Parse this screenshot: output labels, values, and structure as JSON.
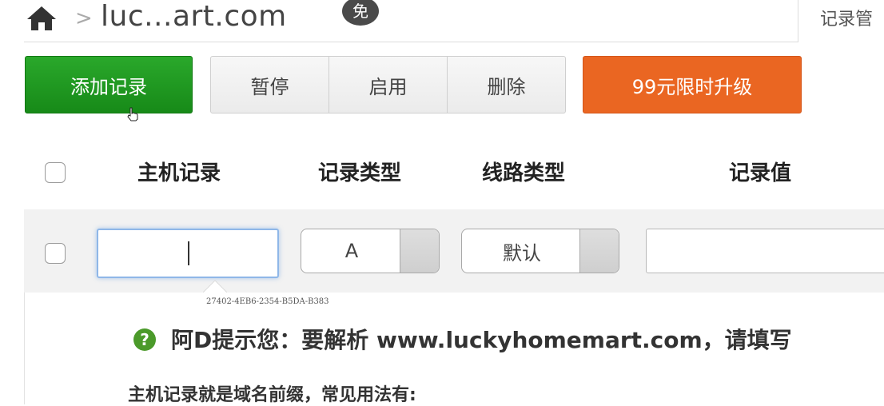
{
  "breadcrumb": {
    "domain": "luc...art.com",
    "badge": "免"
  },
  "top_right": {
    "link": "记录管"
  },
  "toolbar": {
    "add_label": "添加记录",
    "pause_label": "暂停",
    "enable_label": "启用",
    "delete_label": "删除",
    "upgrade_label": "99元限时升级"
  },
  "table": {
    "headers": [
      "主机记录",
      "记录类型",
      "线路类型",
      "记录值"
    ]
  },
  "edit_row": {
    "host_value": "",
    "record_type": "A",
    "line_type": "默认",
    "record_value": ""
  },
  "tip": {
    "serial": "27402-4EB6-2354-B5DA-B383",
    "headline": "阿D提示您：要解析 www.luckyhomemart.com，请填写",
    "subline": "主机记录就是域名前缀，常见用法有:"
  },
  "colors": {
    "add_button": "#1f9a20",
    "upgrade_button": "#ea6622",
    "focus_border": "#8fb7e8",
    "help_icon": "#4b9a2a"
  },
  "icons": [
    "home-icon",
    "free-badge",
    "pointer-cursor-icon",
    "help-icon"
  ]
}
